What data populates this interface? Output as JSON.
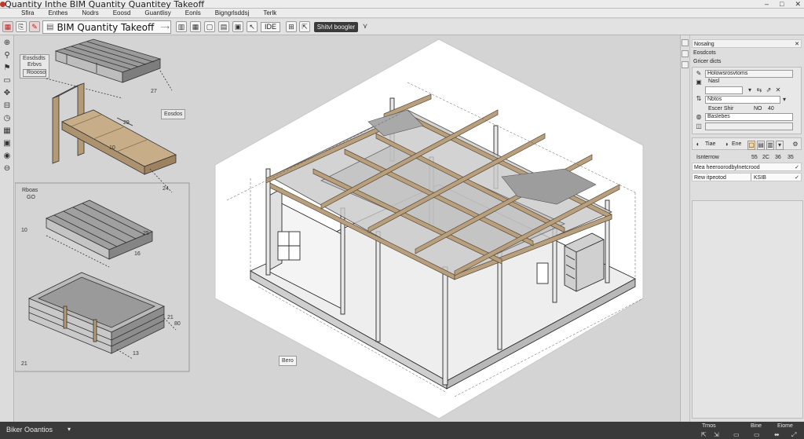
{
  "window": {
    "title": "Quantity Inthe BIM Quantity Quantitey Takeoff",
    "controls": [
      "–",
      "□",
      "✕"
    ]
  },
  "menu": {
    "items": [
      "Sfira",
      "Enthes",
      "Nodrs",
      "Eoosd",
      "Guantlisy",
      "Eonls",
      "Bigngrlsddsj",
      "Terlk"
    ]
  },
  "toolbar": {
    "title_label": "BIM Quantity Takeoff",
    "id_label": "IDE",
    "dark_label": "Shitvl boogler"
  },
  "canvas": {
    "top_group": {
      "tag_lines": [
        "Eosdsdts",
        "Erbvs",
        "Roooso"
      ],
      "tag_side": "Eosdos"
    },
    "bottom_group": {
      "tag_lines": [
        "Rboas",
        "GO"
      ]
    },
    "dims": [
      "27",
      "29",
      "10",
      "24",
      "25",
      "16",
      "21",
      "80",
      "13",
      "10",
      "21"
    ],
    "view_tag": "Bero"
  },
  "right_panel": {
    "section_rows": [
      "Nosalng",
      "Eosdcots",
      "Gricer dicts"
    ],
    "props_title": "Holowsrosvtoms",
    "props_sub": "Nasl",
    "field_a": "",
    "field_b": "Nbtos",
    "row_label": "Escer  Shir",
    "row_vals": [
      "NO",
      "40"
    ],
    "field_c": "Baslebes",
    "mode_label": "Tiae",
    "mode_label2": "Ene",
    "table_header": "Isnterrow",
    "table_nums": [
      "55",
      "2C",
      "36",
      "35"
    ],
    "list_rows": [
      {
        "label": "Mea heeroorodbylnetcrood",
        "value": ""
      },
      {
        "label": "Rew itpeotod",
        "value": "KSIB"
      }
    ]
  },
  "status": {
    "left_label": "Biker Ooantios",
    "items": [
      "Trnos",
      "Bine",
      "Eiome"
    ],
    "icons": [
      "⇱",
      "⇲",
      "▭",
      "▭",
      "⬌",
      "⤢"
    ]
  }
}
